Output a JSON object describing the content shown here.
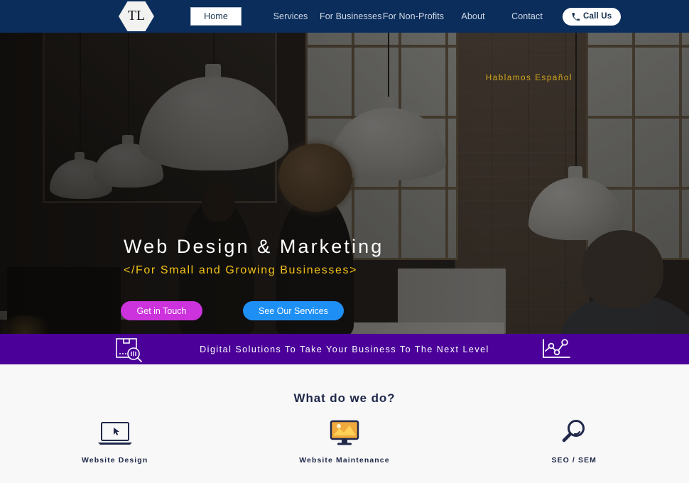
{
  "site": {
    "logo_text": "TL",
    "logo_shape": "hexagon"
  },
  "nav": {
    "items": [
      {
        "label": "Home",
        "active": true
      },
      {
        "label": "Services",
        "active": false
      },
      {
        "label": "For Businesses",
        "active": false
      },
      {
        "label": "For Non-Profits",
        "active": false
      },
      {
        "label": "About",
        "active": false
      },
      {
        "label": "Contact",
        "active": false
      }
    ],
    "cta": {
      "label": "Call Us",
      "icon": "phone-icon"
    },
    "bar_color": "#0a2d5c",
    "active_bg": "#ffffff"
  },
  "hero": {
    "tagline": "Hablamos Español",
    "tagline_color": "#d5a81c",
    "title": "Web Design & Marketing",
    "subtitle": "</For Small and Growing Businesses>",
    "subtitle_color": "#f2c116",
    "buttons": [
      {
        "label": "Get in Touch",
        "color": "#cc33dd"
      },
      {
        "label": "See Our Services",
        "color": "#1e90f5"
      }
    ]
  },
  "banner": {
    "text": "Digital Solutions To Take Your Business To The Next Level",
    "background": "#4a0099",
    "left_icon": "package-search-icon",
    "right_icon": "line-chart-icon"
  },
  "services": {
    "heading": "What do we do?",
    "heading_color": "#20284a",
    "items": [
      {
        "label": "Website Design",
        "icon": "laptop-cursor-icon"
      },
      {
        "label": "Website Maintenance",
        "icon": "monitor-screen-icon"
      },
      {
        "label": "SEO / SEM",
        "icon": "magnifier-icon"
      }
    ]
  }
}
